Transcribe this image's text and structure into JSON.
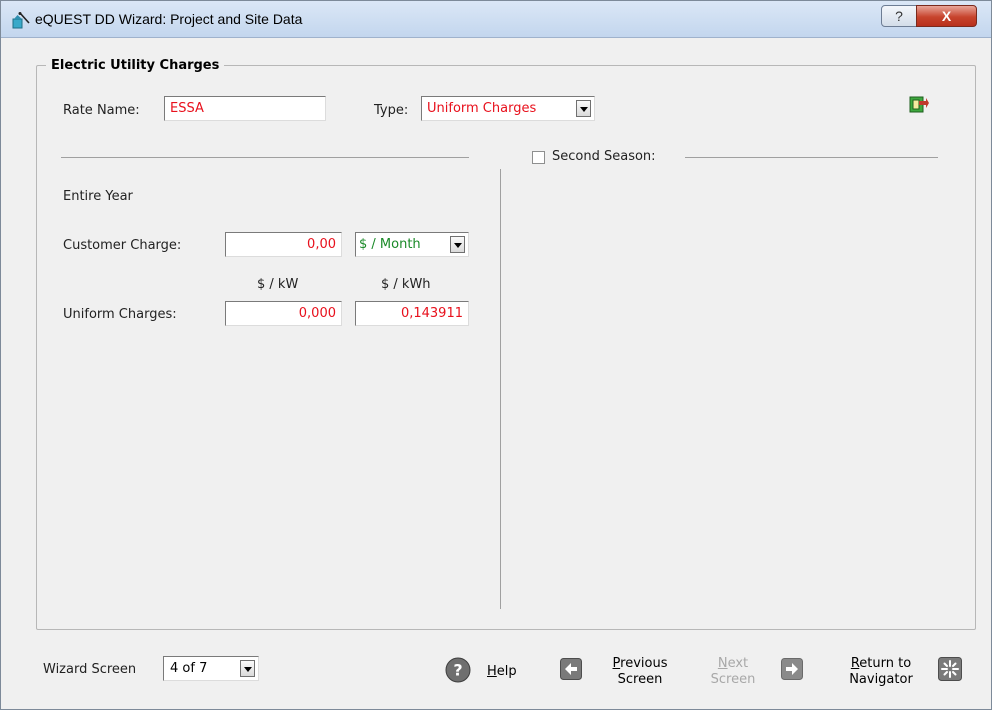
{
  "window": {
    "title": "eQUEST DD Wizard: Project and Site Data",
    "help_glyph": "?",
    "close_glyph": "X"
  },
  "group": {
    "title": "Electric Utility Charges"
  },
  "rate": {
    "name_label": "Rate Name:",
    "name_value": "ESSA",
    "type_label": "Type:",
    "type_value": "Uniform Charges"
  },
  "second_season": {
    "label": "Second Season:",
    "checked": false
  },
  "entire_year": {
    "heading": "Entire Year",
    "customer_charge_label": "Customer Charge:",
    "customer_charge_value": "0,00",
    "customer_charge_unit": "$ / Month",
    "col_kw_label": "$ / kW",
    "col_kwh_label": "$ / kWh",
    "uniform_charges_label": "Uniform Charges:",
    "kw_value": "0,000",
    "kwh_value": "0,143911"
  },
  "footer": {
    "wizard_screen_label": "Wizard Screen",
    "wizard_screen_value": "4 of 7",
    "help_label": "Help",
    "previous_line1": "Previous",
    "previous_line2": "Screen",
    "next_line1": "Next",
    "next_line2": "Screen",
    "return_line1": "Return to",
    "return_line2": "Navigator"
  },
  "colors": {
    "value_red": "#e8101c",
    "unit_green": "#1a8a28",
    "nav_icon": "#808080"
  },
  "icons": [
    "app-icon",
    "export-icon",
    "checkbox",
    "help-icon",
    "arrow-left-icon",
    "arrow-right-icon",
    "navigator-icon"
  ]
}
